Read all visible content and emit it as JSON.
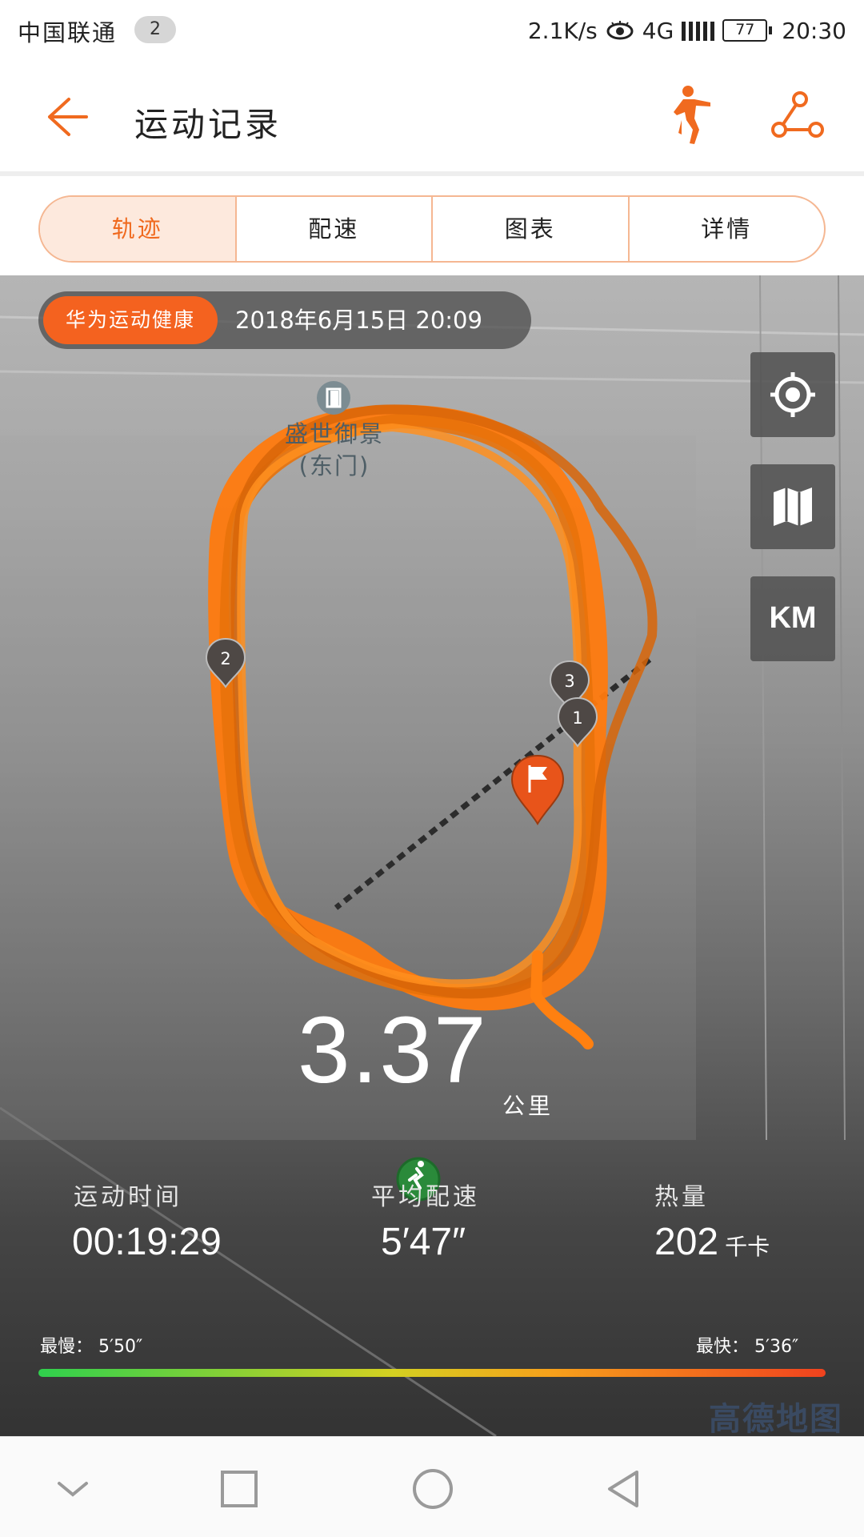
{
  "status_bar": {
    "carrier": "中国联通",
    "sim_badge": "2",
    "network_speed": "2.1K/s",
    "network_type": "4G",
    "battery": "77",
    "time": "20:30"
  },
  "header": {
    "title": "运动记录",
    "accent_color": "#f06a1f"
  },
  "tabs": [
    {
      "label": "轨迹",
      "active": true
    },
    {
      "label": "配速",
      "active": false
    },
    {
      "label": "图表",
      "active": false
    },
    {
      "label": "详情",
      "active": false
    }
  ],
  "map": {
    "source_tag": "华为运动健康",
    "record_datetime": "2018年6月15日 20:09",
    "poi_name_line1": "盛世御景",
    "poi_name_line2": "(东门)",
    "km_button": "KM",
    "markers": [
      "1",
      "2",
      "3"
    ],
    "map_provider": "高德地图"
  },
  "summary": {
    "distance": "3.37",
    "distance_unit": "公里",
    "duration_label": "运动时间",
    "duration_value": "00:19:29",
    "avg_pace_label": "平均配速",
    "avg_pace_value": "5′47″",
    "calories_label": "热量",
    "calories_value": "202",
    "calories_unit": "千卡"
  },
  "pace_range": {
    "slowest_label": "最慢：",
    "slowest_value": "5′50″",
    "fastest_label": "最快：",
    "fastest_value": "5′36″"
  },
  "icons": {
    "back": "arrow-left-icon",
    "run": "runner-icon",
    "route": "route-share-icon",
    "locate": "locate-icon",
    "map_layer": "map-layer-icon"
  }
}
